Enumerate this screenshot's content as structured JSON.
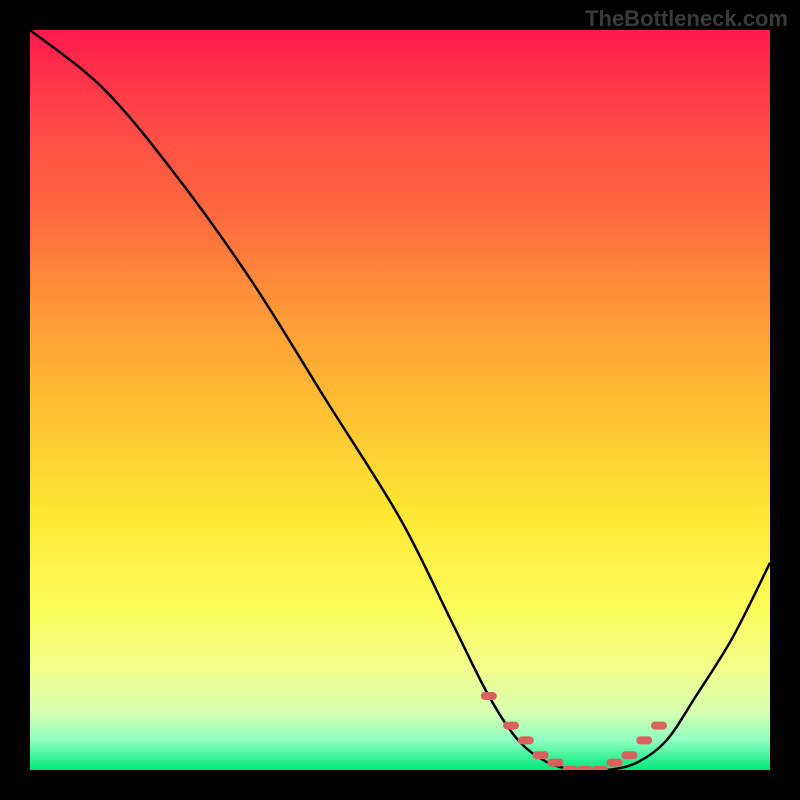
{
  "watermark": "TheBottleneck.com",
  "chart_data": {
    "type": "line",
    "title": "",
    "xlabel": "",
    "ylabel": "",
    "xlim": [
      0,
      100
    ],
    "ylim": [
      0,
      100
    ],
    "x": [
      0,
      10,
      20,
      30,
      40,
      50,
      57,
      62,
      66,
      70,
      74,
      78,
      82,
      86,
      90,
      95,
      100
    ],
    "values": [
      100,
      92,
      80,
      66,
      50,
      34,
      20,
      10,
      4,
      1,
      0,
      0,
      1,
      4,
      10,
      18,
      28
    ],
    "highlight_points": {
      "x": [
        62,
        65,
        67,
        69,
        71,
        73,
        75,
        77,
        79,
        81,
        83,
        85
      ],
      "y": [
        10,
        6,
        4,
        2,
        1,
        0,
        0,
        0,
        1,
        2,
        4,
        6
      ]
    },
    "colors": {
      "curve": "#000000",
      "points": "#d9625f"
    }
  }
}
